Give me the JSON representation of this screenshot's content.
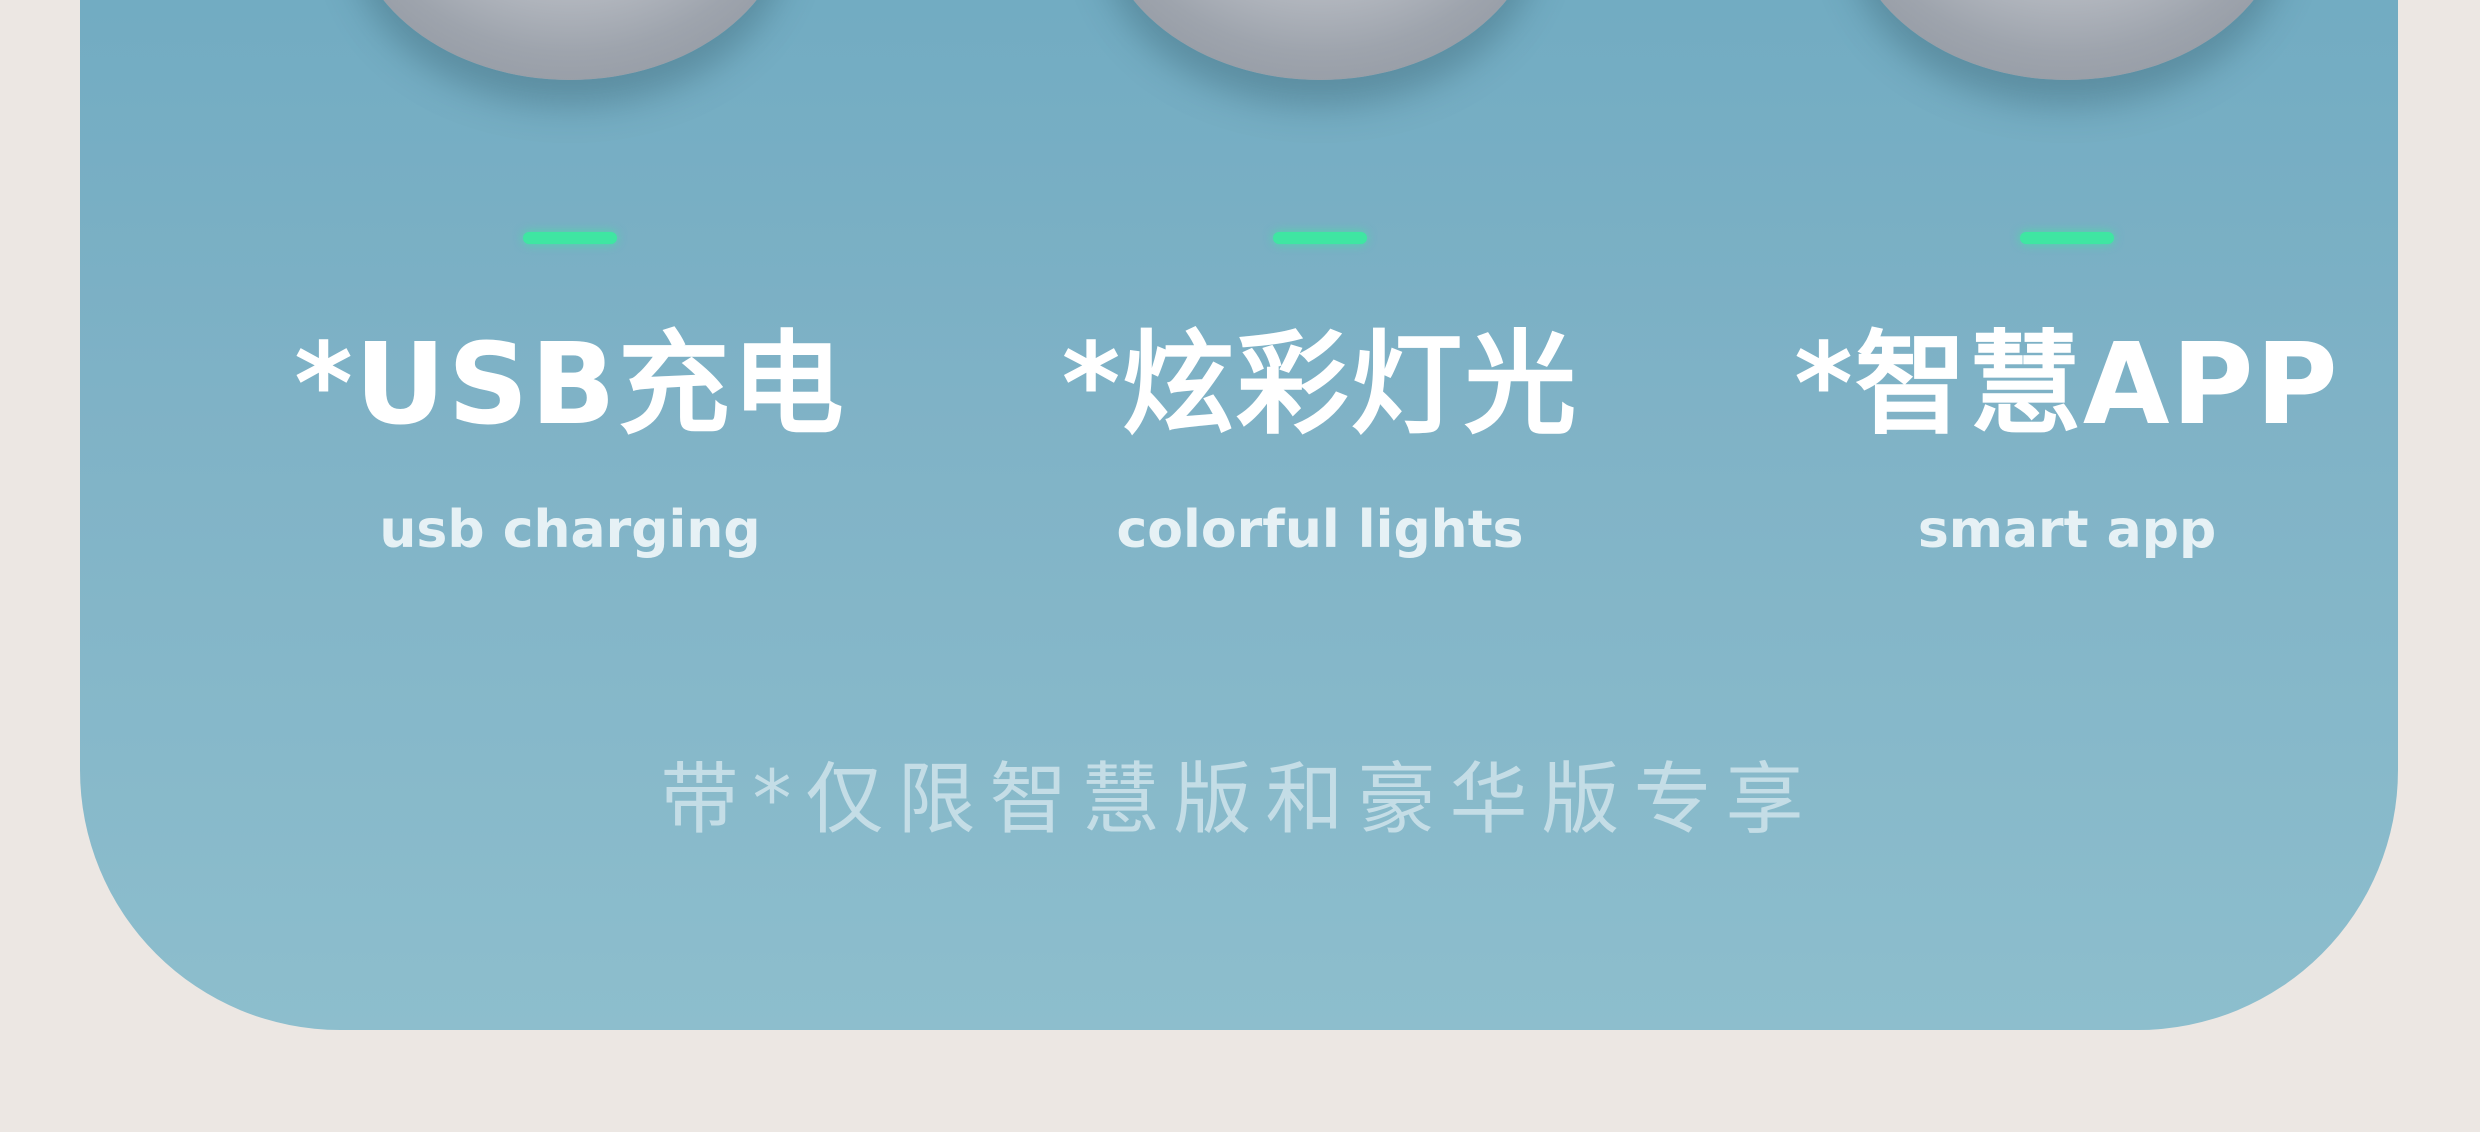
{
  "colors": {
    "background": "#ece7e3",
    "panel": "#7fb2c6",
    "indicator": "#3fe6a2",
    "title_text": "#ffffff",
    "subtitle_text": "#e6f1f5",
    "note_text": "#c4dde6"
  },
  "features": [
    {
      "title": "*USB充电",
      "subtitle": "usb charging",
      "icon": "knob-icon"
    },
    {
      "title": "*炫彩灯光",
      "subtitle": "colorful lights",
      "icon": "knob-icon"
    },
    {
      "title": "*智慧APP",
      "subtitle": "smart app",
      "icon": "knob-icon"
    }
  ],
  "footnote": "带*仅限智慧版和豪华版专享"
}
